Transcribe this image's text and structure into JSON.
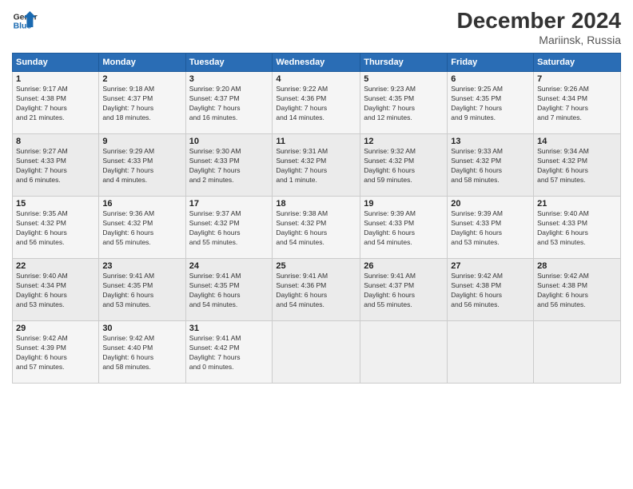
{
  "header": {
    "logo_line1": "General",
    "logo_line2": "Blue",
    "month_title": "December 2024",
    "location": "Mariinsk, Russia"
  },
  "weekdays": [
    "Sunday",
    "Monday",
    "Tuesday",
    "Wednesday",
    "Thursday",
    "Friday",
    "Saturday"
  ],
  "weeks": [
    [
      {
        "day": "1",
        "info": "Sunrise: 9:17 AM\nSunset: 4:38 PM\nDaylight: 7 hours\nand 21 minutes."
      },
      {
        "day": "2",
        "info": "Sunrise: 9:18 AM\nSunset: 4:37 PM\nDaylight: 7 hours\nand 18 minutes."
      },
      {
        "day": "3",
        "info": "Sunrise: 9:20 AM\nSunset: 4:37 PM\nDaylight: 7 hours\nand 16 minutes."
      },
      {
        "day": "4",
        "info": "Sunrise: 9:22 AM\nSunset: 4:36 PM\nDaylight: 7 hours\nand 14 minutes."
      },
      {
        "day": "5",
        "info": "Sunrise: 9:23 AM\nSunset: 4:35 PM\nDaylight: 7 hours\nand 12 minutes."
      },
      {
        "day": "6",
        "info": "Sunrise: 9:25 AM\nSunset: 4:35 PM\nDaylight: 7 hours\nand 9 minutes."
      },
      {
        "day": "7",
        "info": "Sunrise: 9:26 AM\nSunset: 4:34 PM\nDaylight: 7 hours\nand 7 minutes."
      }
    ],
    [
      {
        "day": "8",
        "info": "Sunrise: 9:27 AM\nSunset: 4:33 PM\nDaylight: 7 hours\nand 6 minutes."
      },
      {
        "day": "9",
        "info": "Sunrise: 9:29 AM\nSunset: 4:33 PM\nDaylight: 7 hours\nand 4 minutes."
      },
      {
        "day": "10",
        "info": "Sunrise: 9:30 AM\nSunset: 4:33 PM\nDaylight: 7 hours\nand 2 minutes."
      },
      {
        "day": "11",
        "info": "Sunrise: 9:31 AM\nSunset: 4:32 PM\nDaylight: 7 hours\nand 1 minute."
      },
      {
        "day": "12",
        "info": "Sunrise: 9:32 AM\nSunset: 4:32 PM\nDaylight: 6 hours\nand 59 minutes."
      },
      {
        "day": "13",
        "info": "Sunrise: 9:33 AM\nSunset: 4:32 PM\nDaylight: 6 hours\nand 58 minutes."
      },
      {
        "day": "14",
        "info": "Sunrise: 9:34 AM\nSunset: 4:32 PM\nDaylight: 6 hours\nand 57 minutes."
      }
    ],
    [
      {
        "day": "15",
        "info": "Sunrise: 9:35 AM\nSunset: 4:32 PM\nDaylight: 6 hours\nand 56 minutes."
      },
      {
        "day": "16",
        "info": "Sunrise: 9:36 AM\nSunset: 4:32 PM\nDaylight: 6 hours\nand 55 minutes."
      },
      {
        "day": "17",
        "info": "Sunrise: 9:37 AM\nSunset: 4:32 PM\nDaylight: 6 hours\nand 55 minutes."
      },
      {
        "day": "18",
        "info": "Sunrise: 9:38 AM\nSunset: 4:32 PM\nDaylight: 6 hours\nand 54 minutes."
      },
      {
        "day": "19",
        "info": "Sunrise: 9:39 AM\nSunset: 4:33 PM\nDaylight: 6 hours\nand 54 minutes."
      },
      {
        "day": "20",
        "info": "Sunrise: 9:39 AM\nSunset: 4:33 PM\nDaylight: 6 hours\nand 53 minutes."
      },
      {
        "day": "21",
        "info": "Sunrise: 9:40 AM\nSunset: 4:33 PM\nDaylight: 6 hours\nand 53 minutes."
      }
    ],
    [
      {
        "day": "22",
        "info": "Sunrise: 9:40 AM\nSunset: 4:34 PM\nDaylight: 6 hours\nand 53 minutes."
      },
      {
        "day": "23",
        "info": "Sunrise: 9:41 AM\nSunset: 4:35 PM\nDaylight: 6 hours\nand 53 minutes."
      },
      {
        "day": "24",
        "info": "Sunrise: 9:41 AM\nSunset: 4:35 PM\nDaylight: 6 hours\nand 54 minutes."
      },
      {
        "day": "25",
        "info": "Sunrise: 9:41 AM\nSunset: 4:36 PM\nDaylight: 6 hours\nand 54 minutes."
      },
      {
        "day": "26",
        "info": "Sunrise: 9:41 AM\nSunset: 4:37 PM\nDaylight: 6 hours\nand 55 minutes."
      },
      {
        "day": "27",
        "info": "Sunrise: 9:42 AM\nSunset: 4:38 PM\nDaylight: 6 hours\nand 56 minutes."
      },
      {
        "day": "28",
        "info": "Sunrise: 9:42 AM\nSunset: 4:38 PM\nDaylight: 6 hours\nand 56 minutes."
      }
    ],
    [
      {
        "day": "29",
        "info": "Sunrise: 9:42 AM\nSunset: 4:39 PM\nDaylight: 6 hours\nand 57 minutes."
      },
      {
        "day": "30",
        "info": "Sunrise: 9:42 AM\nSunset: 4:40 PM\nDaylight: 6 hours\nand 58 minutes."
      },
      {
        "day": "31",
        "info": "Sunrise: 9:41 AM\nSunset: 4:42 PM\nDaylight: 7 hours\nand 0 minutes."
      },
      {
        "day": "",
        "info": ""
      },
      {
        "day": "",
        "info": ""
      },
      {
        "day": "",
        "info": ""
      },
      {
        "day": "",
        "info": ""
      }
    ]
  ]
}
